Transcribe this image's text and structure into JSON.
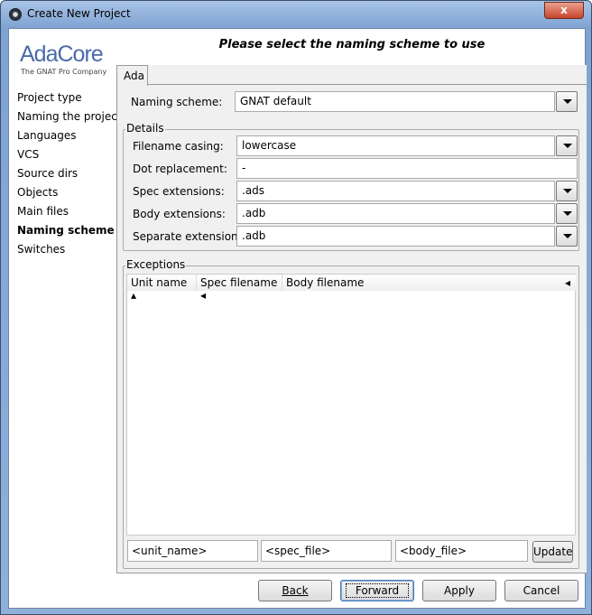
{
  "window": {
    "title": "Create New Project",
    "close_label": "x"
  },
  "logo": {
    "name": "AdaCore",
    "tagline": "The GNAT Pro Company"
  },
  "heading": "Please select the naming scheme to use",
  "sidebar": {
    "items": [
      {
        "label": "Project type"
      },
      {
        "label": "Naming the project"
      },
      {
        "label": "Languages"
      },
      {
        "label": "VCS"
      },
      {
        "label": "Source dirs"
      },
      {
        "label": "Objects"
      },
      {
        "label": "Main files"
      },
      {
        "label": "Naming scheme",
        "selected": true
      },
      {
        "label": "Switches"
      }
    ]
  },
  "tabs": [
    {
      "label": "Ada",
      "active": true
    }
  ],
  "naming_scheme": {
    "label": "Naming scheme:",
    "value": "GNAT default"
  },
  "details": {
    "legend": "Details",
    "rows": [
      {
        "label": "Filename casing:",
        "value": "lowercase",
        "dropdown": true
      },
      {
        "label": "Dot replacement:",
        "value": "-",
        "dropdown": false
      },
      {
        "label": "Spec extensions:",
        "value": ".ads",
        "dropdown": true
      },
      {
        "label": "Body extensions:",
        "value": ".adb",
        "dropdown": true
      },
      {
        "label": "Separate extensions:",
        "value": ".adb",
        "dropdown": true
      }
    ]
  },
  "exceptions": {
    "legend": "Exceptions",
    "columns": [
      {
        "label": "Unit name",
        "sort": "ascending"
      },
      {
        "label": "Spec filename"
      },
      {
        "label": "Body filename"
      }
    ],
    "rows": [],
    "inputs": {
      "unit": "<unit_name>",
      "spec": "<spec_file>",
      "body": "<body_file>"
    },
    "update_label": "Update"
  },
  "buttons": {
    "back": "Back",
    "forward": "Forward",
    "apply": "Apply",
    "cancel": "Cancel"
  }
}
